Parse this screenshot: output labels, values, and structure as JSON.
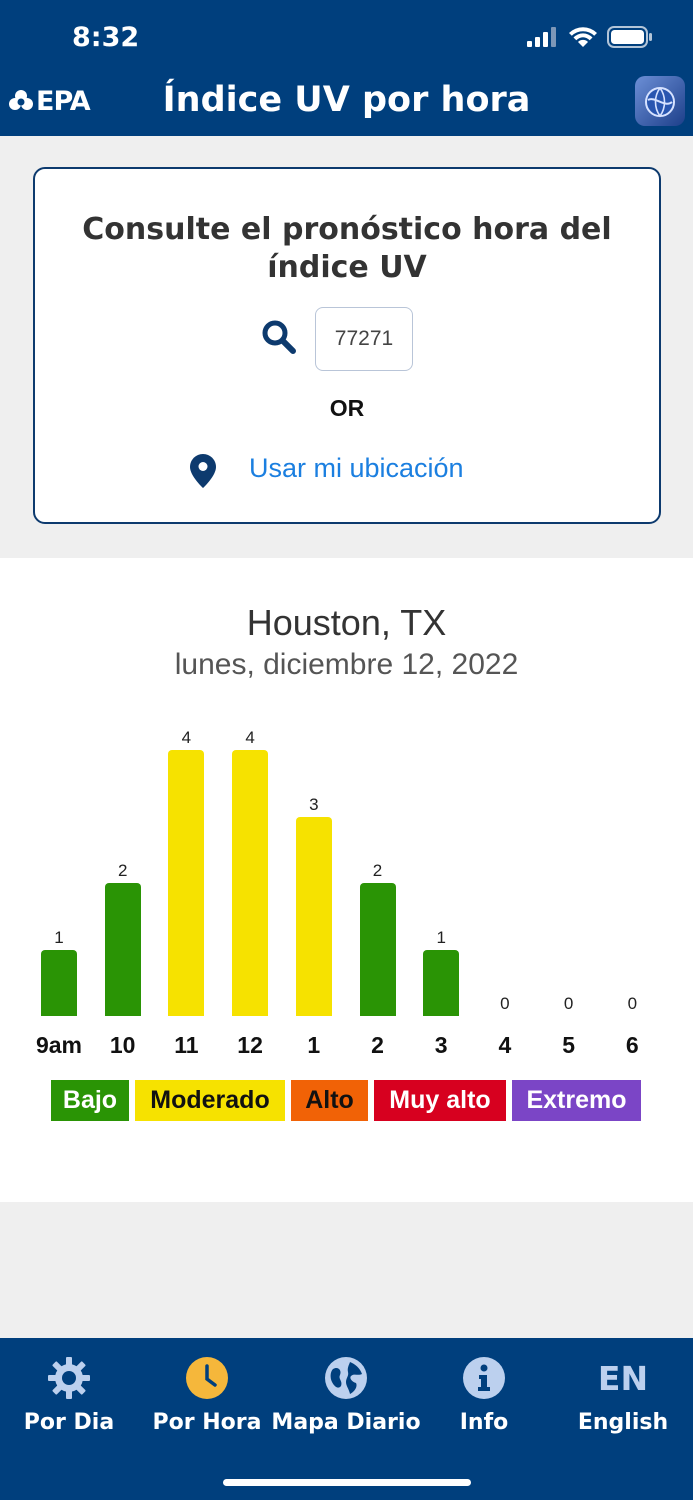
{
  "status_bar": {
    "time": "8:32"
  },
  "header": {
    "logo_text": "EPA",
    "title": "Índice UV por hora"
  },
  "search": {
    "heading": "Consulte el pronóstico hora del índice UV",
    "zip_value": "77271",
    "or_label": "OR",
    "location_label": "Usar mi ubicación"
  },
  "forecast": {
    "city": "Houston, TX",
    "date": "lunes, diciembre 12, 2022"
  },
  "chart_data": {
    "type": "bar",
    "categories": [
      "9am",
      "10",
      "11",
      "12",
      "1",
      "2",
      "3",
      "4",
      "5",
      "6"
    ],
    "values": [
      1,
      2,
      4,
      4,
      3,
      2,
      1,
      0,
      0,
      0
    ],
    "ylim": [
      0,
      4
    ],
    "colors": {
      "low": "#2a9405",
      "moderate": "#f6e200"
    }
  },
  "legend": [
    {
      "label": "Bajo",
      "color": "#2a9405",
      "text_color": "#ffffff"
    },
    {
      "label": "Moderado",
      "color": "#f6e200",
      "text_color": "#111111"
    },
    {
      "label": "Alto",
      "color": "#f16206",
      "text_color": "#111111"
    },
    {
      "label": "Muy alto",
      "color": "#d7001f",
      "text_color": "#ffffff"
    },
    {
      "label": "Extremo",
      "color": "#7b45c6",
      "text_color": "#ffffff"
    }
  ],
  "tabs": [
    {
      "label": "Por Dia",
      "icon": "gear-icon",
      "active": false
    },
    {
      "label": "Por Hora",
      "icon": "clock-icon",
      "active": true
    },
    {
      "label": "Mapa Diario",
      "icon": "globe-icon",
      "active": false
    },
    {
      "label": "Info",
      "icon": "info-icon",
      "active": false
    },
    {
      "label": "English",
      "icon": "EN",
      "active": false
    }
  ]
}
